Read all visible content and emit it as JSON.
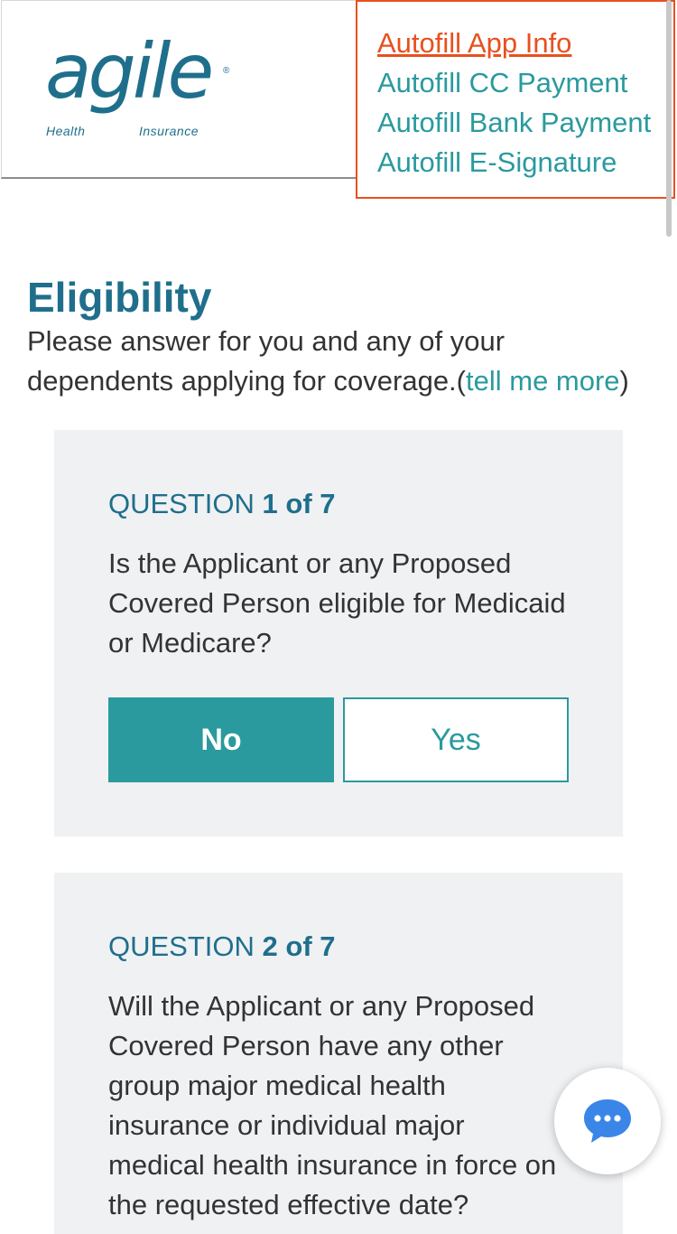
{
  "brand": {
    "name": "agile",
    "sub_left": "Health",
    "sub_right": "Insurance",
    "color": "#1f6f8c"
  },
  "autofill": {
    "links": [
      {
        "label": "Autofill App Info",
        "active": true
      },
      {
        "label": "Autofill CC Payment",
        "active": false
      },
      {
        "label": "Autofill Bank Payment",
        "active": false
      },
      {
        "label": "Autofill E-Signature",
        "active": false
      }
    ],
    "border_color": "#e8501f",
    "link_color": "#2a9a9e"
  },
  "page": {
    "title": "Eligibility",
    "intro": "Please answer for you and any of your dependents applying for coverage.(",
    "intro_link": "tell me more",
    "intro_close": ")"
  },
  "questions": [
    {
      "prefix": "QUESTION",
      "number": "1 of 7",
      "text": "Is the Applicant or any Proposed Covered Person eligible for Medicaid or Medicare?",
      "options": [
        "No",
        "Yes"
      ],
      "selected": "No"
    },
    {
      "prefix": "QUESTION",
      "number": "2 of 7",
      "text": "Will the Applicant or any Proposed Covered Person have any other group major medical health insurance or individual major medical health insurance in force on the requested effective date?"
    }
  ],
  "chat": {
    "icon": "chat-bubble-icon",
    "color": "#3a86e8"
  },
  "colors": {
    "primary": "#1f6f8c",
    "accent": "#2a9a9e",
    "card_bg": "#f0f1f3"
  }
}
